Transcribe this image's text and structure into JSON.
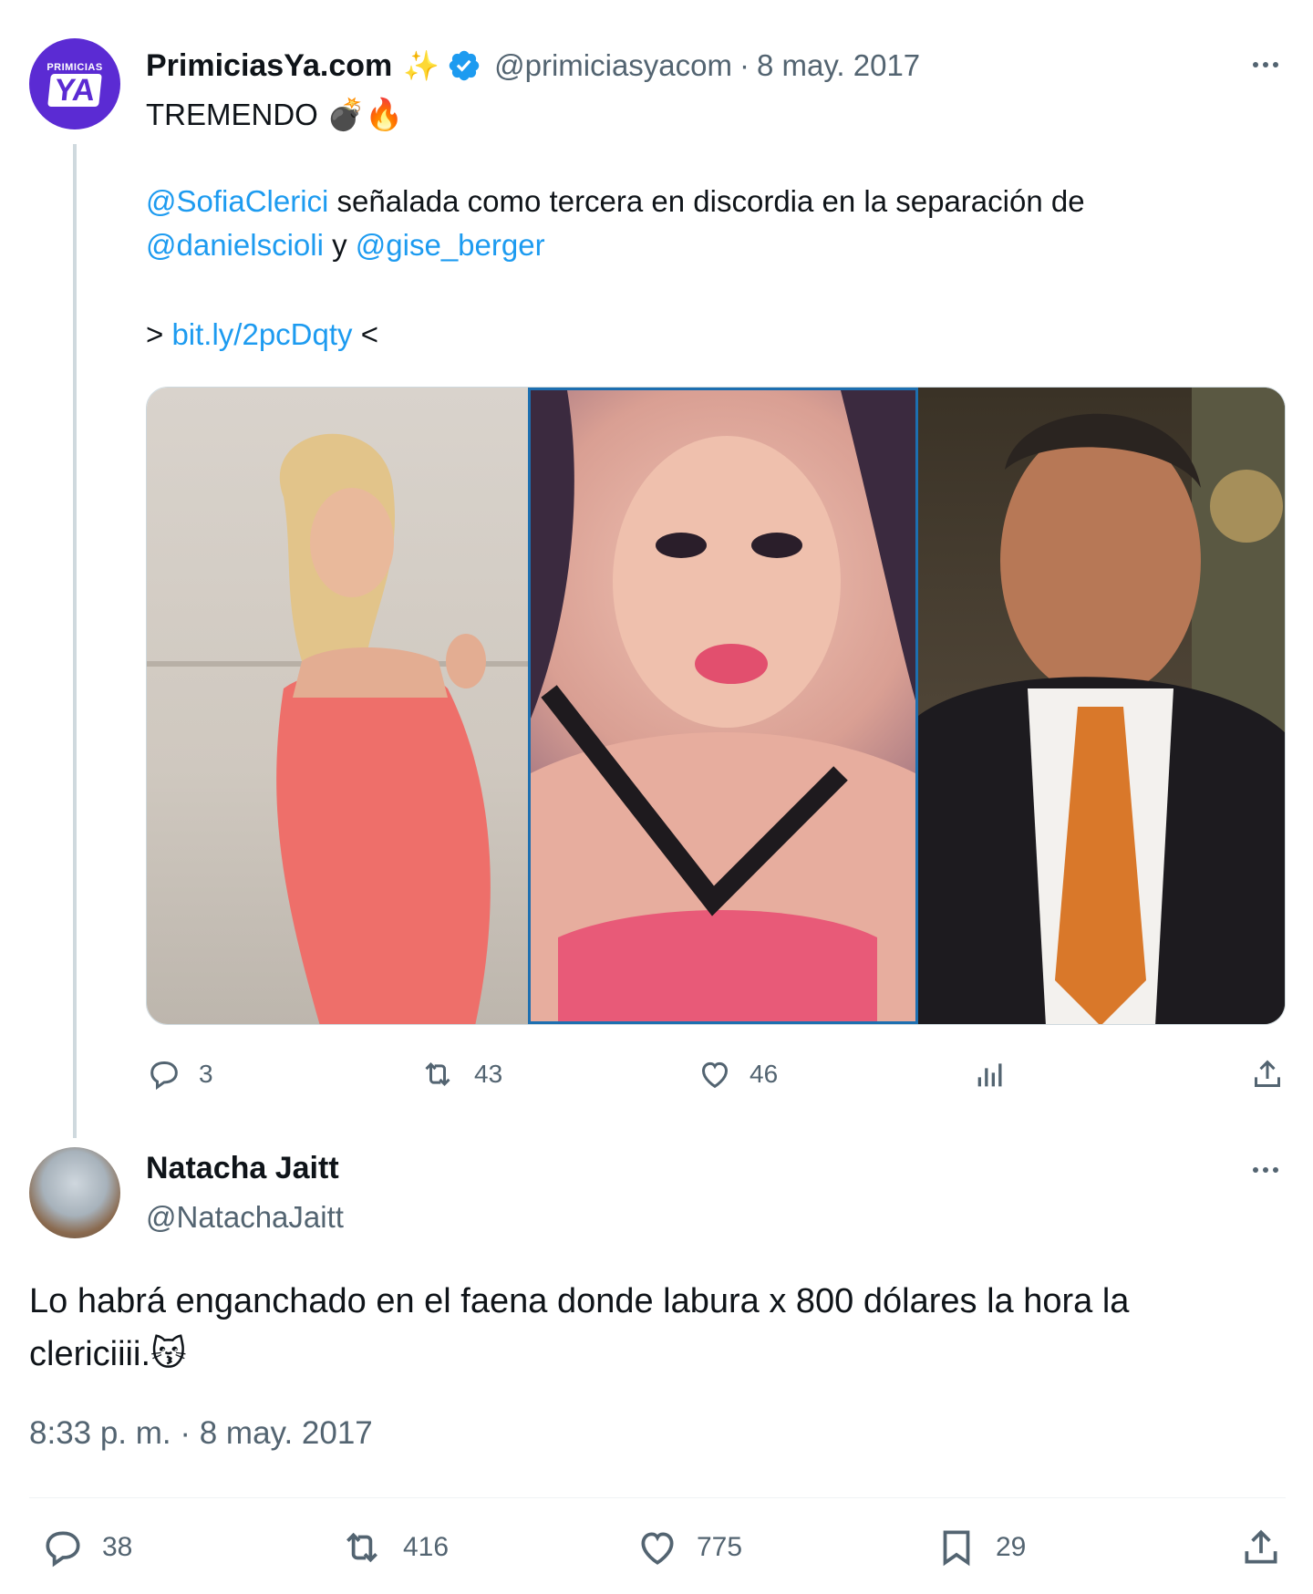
{
  "quoted_tweet": {
    "display_name": "PrimiciasYa.com",
    "sparkle": "✨",
    "handle": "@primiciasyacom",
    "separator": "·",
    "date": "8 may. 2017",
    "avatar_text_small": "PRIMICIAS",
    "avatar_text_big": "YA",
    "line1": "TREMENDO",
    "line1_emojis": "💣🔥",
    "mention1": "@SofiaClerici",
    "line2_rest": " señalada como tercera en discordia en la separación de",
    "mention2": "@danielscioli",
    "line3_and": " y ",
    "mention3": "@gise_berger",
    "link_prefix": "> ",
    "link": "bit.ly/2pcDqty",
    "link_suffix": " <",
    "replies": "3",
    "retweets": "43",
    "likes": "46"
  },
  "main_tweet": {
    "display_name": "Natacha Jaitt",
    "handle": "@NatachaJaitt",
    "text": "Lo habrá enganchado en el faena donde labura x 800 dólares la hora la clericiiii.",
    "emoji": "😽",
    "timestamp": "8:33 p. m. · 8 may. 2017",
    "replies": "38",
    "retweets": "416",
    "likes": "775",
    "bookmarks": "29"
  },
  "colors": {
    "accent": "#1d9bf0",
    "secondary_text": "#536471",
    "primary_text": "#0f1419",
    "brand_purple": "#5b2bd3"
  }
}
